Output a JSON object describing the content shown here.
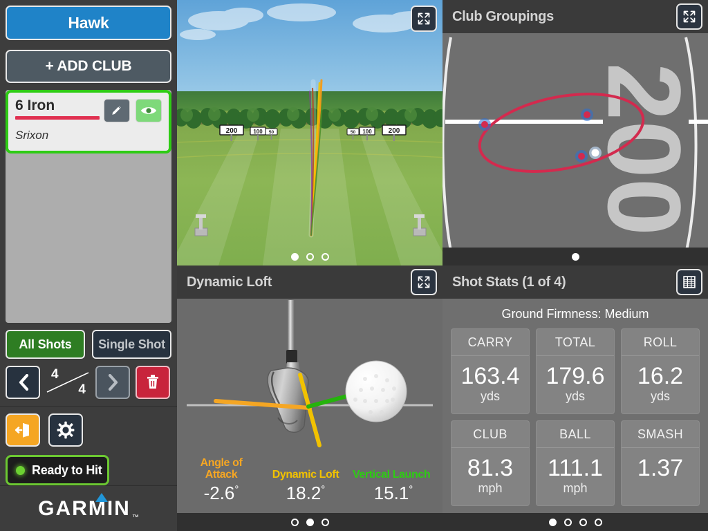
{
  "sidebar": {
    "device_name": "Hawk",
    "add_club_label": "+ ADD CLUB",
    "club": {
      "name": "6 Iron",
      "ball": "Srixon",
      "color": "#e03050",
      "edit_icon": "pencil-icon",
      "visibility_icon": "eye-icon"
    },
    "mode": {
      "all_shots_label": "All Shots",
      "single_shot_label": "Single Shot",
      "selected": "All Shots"
    },
    "navigation": {
      "prev_icon": "chevron-left-icon",
      "next_icon": "chevron-right-icon",
      "delete_icon": "trash-icon",
      "shot_index": "4",
      "shot_total": "4"
    },
    "utilities": {
      "exit_icon": "exit-door-icon",
      "settings_icon": "gear-icon"
    },
    "status": {
      "label": "Ready to Hit",
      "indicator_color": "#6cd132"
    },
    "brand": {
      "name": "GARMIN",
      "tm": "TM"
    }
  },
  "panels": {
    "range": {
      "expand_icon": "expand-icon",
      "pager": {
        "count": 3,
        "active": 0
      },
      "distance_signs": [
        "200",
        "100",
        "50",
        "50",
        "100",
        "200"
      ]
    },
    "club_groupings": {
      "title": "Club Groupings",
      "expand_icon": "expand-icon",
      "range_label": "200",
      "pager": {
        "count": 1,
        "active": 0
      }
    },
    "dynamic_loft": {
      "title": "Dynamic Loft",
      "expand_icon": "expand-icon",
      "pager": {
        "count": 3,
        "active": 1
      },
      "metrics": [
        {
          "label": "Angle of\nAttack",
          "label_line1": "Angle of",
          "label_line2": "Attack",
          "value": "-2.6",
          "unit": "°",
          "color": "#f5a623"
        },
        {
          "label": "Dynamic Loft",
          "label_line1": "Dynamic Loft",
          "label_line2": "",
          "value": "18.2",
          "unit": "°",
          "color": "#f2c200"
        },
        {
          "label": "Vertical Launch",
          "label_line1": "Vertical Launch",
          "label_line2": "",
          "value": "15.1",
          "unit": "°",
          "color": "#2ecc14"
        }
      ]
    },
    "shot_stats": {
      "title": "Shot Stats (1 of 4)",
      "table_icon": "table-icon",
      "ground_firmness": "Ground Firmness: Medium",
      "pager": {
        "count": 4,
        "active": 0
      },
      "stats": [
        {
          "name": "CARRY",
          "value": "163.4",
          "unit": "yds"
        },
        {
          "name": "TOTAL",
          "value": "179.6",
          "unit": "yds"
        },
        {
          "name": "ROLL",
          "value": "16.2",
          "unit": "yds"
        },
        {
          "name": "CLUB",
          "value": "81.3",
          "unit": "mph"
        },
        {
          "name": "BALL",
          "value": "111.1",
          "unit": "mph"
        },
        {
          "name": "SMASH",
          "value": "1.37",
          "unit": ""
        }
      ]
    }
  }
}
